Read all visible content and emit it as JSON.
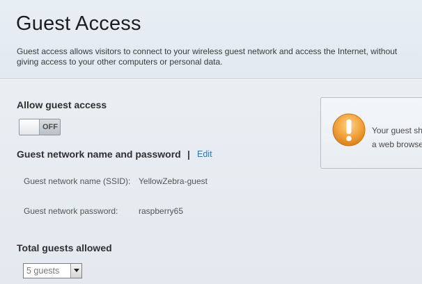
{
  "header": {
    "title": "Guest Access",
    "description": "Guest access allows visitors to connect to your wireless guest network and access the Internet, without giving access to your other computers or personal data."
  },
  "allow_guest": {
    "heading": "Allow guest access",
    "toggle_state": "OFF"
  },
  "network": {
    "heading": "Guest network name and password",
    "separator": "|",
    "edit_label": "Edit",
    "ssid_label": "Guest network name (SSID):",
    "ssid_value": "YellowZebra-guest",
    "password_label": "Guest network password:",
    "password_value": "raspberry65"
  },
  "guests": {
    "heading": "Total guests allowed",
    "selected": "5 guests"
  },
  "alert": {
    "icon": "warning-exclamation-icon",
    "line1": "Your guest sh",
    "line2": "a web browse"
  },
  "colors": {
    "link": "#2a77c0",
    "warning": "#f0a13a"
  }
}
